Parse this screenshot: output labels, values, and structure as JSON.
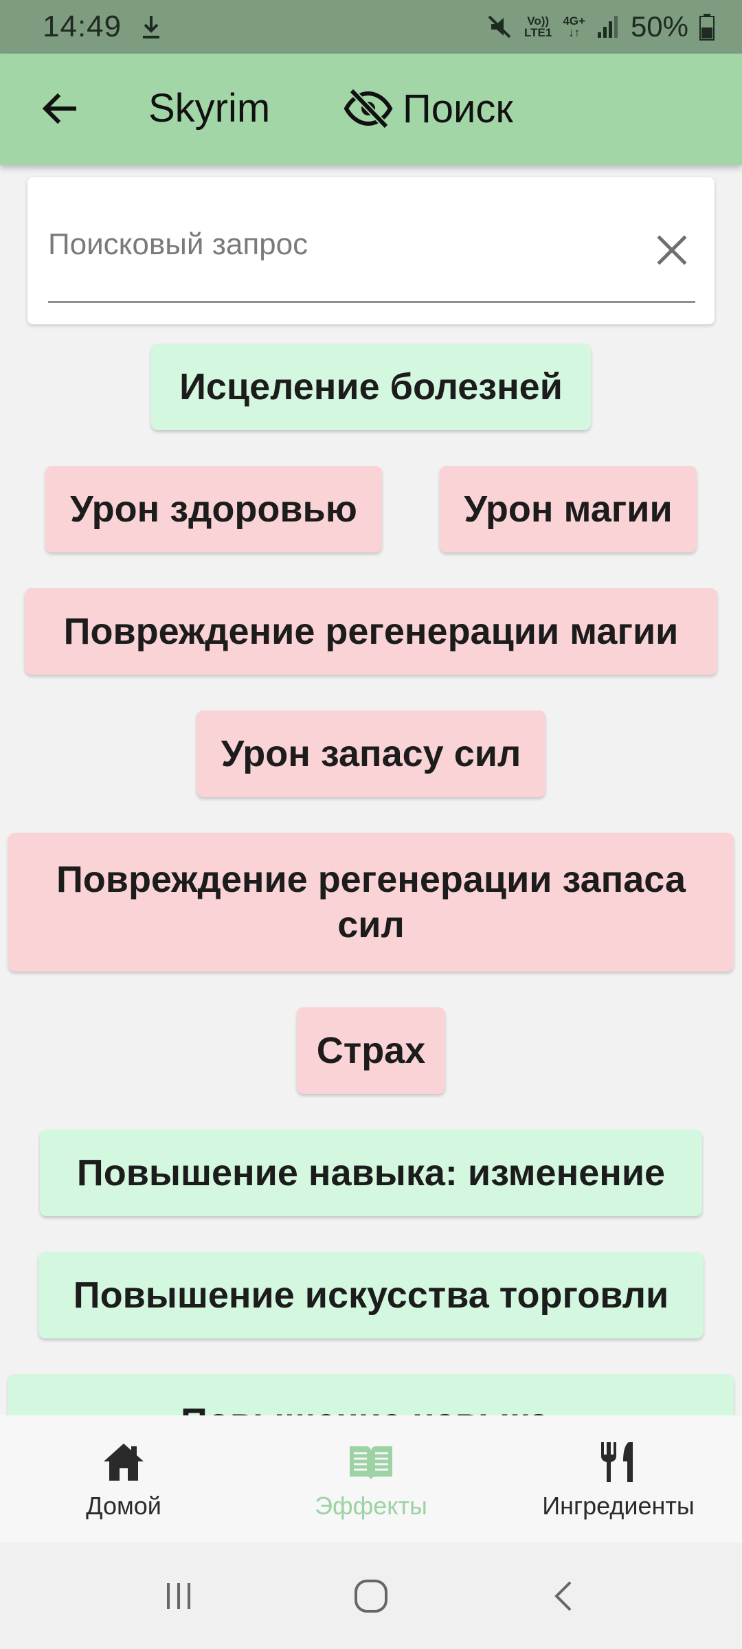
{
  "status_bar": {
    "time": "14:49",
    "volte_line1": "Vo))",
    "volte_line2": "LTE1",
    "network": "4G+",
    "battery": "50%"
  },
  "app_bar": {
    "title": "Skyrim",
    "search_label": "Поиск"
  },
  "search": {
    "placeholder": "Поисковый запрос",
    "value": ""
  },
  "effects": [
    {
      "label": "Исцеление болезней",
      "type": "positive"
    },
    {
      "label": "Урон здоровью",
      "type": "negative"
    },
    {
      "label": "Урон магии",
      "type": "negative"
    },
    {
      "label": "Повреждение регенерации магии",
      "type": "negative"
    },
    {
      "label": "Урон запасу сил",
      "type": "negative"
    },
    {
      "label": "Повреждение регенерации запаса сил",
      "type": "negative"
    },
    {
      "label": "Страх",
      "type": "negative"
    },
    {
      "label": "Повышение навыка: изменение",
      "type": "positive"
    },
    {
      "label": "Повышение искусства торговли",
      "type": "positive"
    },
    {
      "label": "Повышение навыка:",
      "type": "positive"
    }
  ],
  "bottom_nav": {
    "items": [
      {
        "label": "Домой",
        "icon": "home-icon",
        "active": false
      },
      {
        "label": "Эффекты",
        "icon": "book-icon",
        "active": true
      },
      {
        "label": "Ингредиенты",
        "icon": "fork-knife-icon",
        "active": false
      }
    ]
  },
  "colors": {
    "app_bar": "#a3d6a7",
    "positive_chip": "#d4f7e0",
    "negative_chip": "#fad3d6",
    "active_nav": "#9dd2a4"
  }
}
